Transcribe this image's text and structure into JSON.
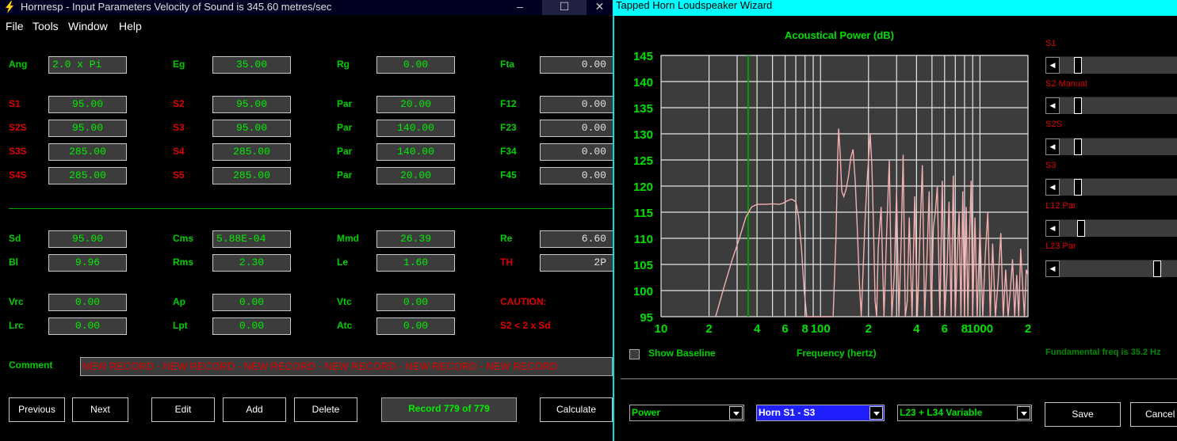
{
  "left_window": {
    "title": "Hornresp - Input Parameters   Velocity of Sound is 345.60 metres/sec",
    "controls": {
      "minimize": "–",
      "maximize": "☐",
      "close": "✕"
    },
    "menu": [
      "File",
      "Tools",
      "Window",
      "Help"
    ],
    "params": {
      "ang": {
        "label": "Ang",
        "value": "2.0 x Pi"
      },
      "eg": {
        "label": "Eg",
        "value": "35.00"
      },
      "rg": {
        "label": "Rg",
        "value": "0.00"
      },
      "fta": {
        "label": "Fta",
        "value": "0.00"
      },
      "s1": {
        "label": "S1",
        "value": "95.00"
      },
      "s2": {
        "label": "S2",
        "value": "95.00"
      },
      "par1": {
        "label": "Par",
        "value": "20.00"
      },
      "f12": {
        "label": "F12",
        "value": "0.00"
      },
      "s2s": {
        "label": "S2S",
        "value": "95.00"
      },
      "s3": {
        "label": "S3",
        "value": "95.00"
      },
      "par2": {
        "label": "Par",
        "value": "140.00"
      },
      "f23": {
        "label": "F23",
        "value": "0.00"
      },
      "s3s": {
        "label": "S3S",
        "value": "285.00"
      },
      "s4": {
        "label": "S4",
        "value": "285.00"
      },
      "par3": {
        "label": "Par",
        "value": "140.00"
      },
      "f34": {
        "label": "F34",
        "value": "0.00"
      },
      "s4s": {
        "label": "S4S",
        "value": "285.00"
      },
      "s5": {
        "label": "S5",
        "value": "285.00"
      },
      "par4": {
        "label": "Par",
        "value": "20.00"
      },
      "f45": {
        "label": "F45",
        "value": "0.00"
      },
      "sd": {
        "label": "Sd",
        "value": "95.00"
      },
      "cms": {
        "label": "Cms",
        "value": "5.88E-04"
      },
      "mmd": {
        "label": "Mmd",
        "value": "26.39"
      },
      "re": {
        "label": "Re",
        "value": "6.60"
      },
      "bl": {
        "label": "Bl",
        "value": "9.96"
      },
      "rms": {
        "label": "Rms",
        "value": "2.30"
      },
      "le": {
        "label": "Le",
        "value": "1.60"
      },
      "th": {
        "label": "TH",
        "value": "2P"
      },
      "vrc": {
        "label": "Vrc",
        "value": "0.00"
      },
      "ap": {
        "label": "Ap",
        "value": "0.00"
      },
      "vtc": {
        "label": "Vtc",
        "value": "0.00"
      },
      "lrc": {
        "label": "Lrc",
        "value": "0.00"
      },
      "lpt": {
        "label": "Lpt",
        "value": "0.00"
      },
      "atc": {
        "label": "Atc",
        "value": "0.00"
      }
    },
    "caution": {
      "title": "CAUTION:",
      "text": "S2 < 2 x Sd"
    },
    "comment": {
      "label": "Comment",
      "value": "NEW RECORD - NEW RECORD - NEW RECORD - NEW RECORD - NEW RECORD - NEW RECORD"
    },
    "buttons": {
      "previous": "Previous",
      "next": "Next",
      "edit": "Edit",
      "add": "Add",
      "delete": "Delete",
      "calculate": "Calculate"
    },
    "record": "Record 779 of 779"
  },
  "right_window": {
    "title": "Tapped Horn Loudspeaker Wizard",
    "sliders": [
      {
        "label": "S1",
        "value": 0.12
      },
      {
        "label": "S2  Manual",
        "value": 0.12
      },
      {
        "label": "S2S",
        "value": 0.12
      },
      {
        "label": "S3",
        "value": 0.12
      },
      {
        "label": "L12  Par",
        "value": 0.15
      },
      {
        "label": "L23  Par",
        "value": 0.8
      }
    ],
    "show_baseline": "Show Baseline",
    "fundamental": "Fundamental freq is 35.2 Hz",
    "dropdowns": {
      "power": "Power",
      "horn": "Horn S1 - S3",
      "variable": "L23 + L34 Variable"
    },
    "buttons": {
      "save": "Save",
      "cancel": "Cancel"
    }
  },
  "chart_data": {
    "type": "line",
    "title": "Acoustical Power (dB)",
    "xlabel": "Frequency (hertz)",
    "ylabel": "",
    "x_scale": "log",
    "xlim": [
      10,
      2000
    ],
    "ylim": [
      95,
      145
    ],
    "y_ticks": [
      "145",
      "140",
      "135",
      "130",
      "125",
      "120",
      "115",
      "110",
      "105",
      "100",
      "95"
    ],
    "x_ticks": [
      "10",
      "2",
      "4",
      "6",
      "8",
      "100",
      "2",
      "4",
      "6",
      "8",
      "1000",
      "2"
    ],
    "marker_freq": 35.2,
    "grid": true,
    "series": [
      {
        "color": "#f4b0b0",
        "x": [
          22,
          25,
          28,
          31,
          34,
          37,
          40,
          45,
          50,
          55,
          58,
          62,
          66,
          70,
          73,
          76,
          79,
          82,
          86,
          90,
          95,
          100,
          105,
          110,
          115,
          120,
          125,
          128,
          130,
          133,
          136,
          140,
          145,
          150,
          155,
          160,
          165,
          170,
          175,
          180,
          185,
          190,
          195,
          200,
          205,
          210,
          215,
          220,
          225,
          230,
          240,
          250,
          260,
          270,
          280,
          290,
          300,
          310,
          320,
          330,
          340,
          350,
          360,
          375,
          390,
          405,
          420,
          435,
          450,
          465,
          480,
          495,
          510,
          525,
          540,
          560,
          580,
          600,
          620,
          640,
          660,
          680,
          700,
          720,
          740,
          760,
          780,
          800,
          820,
          840,
          860,
          880,
          900,
          930,
          960,
          1000,
          1040,
          1080,
          1120,
          1160,
          1200,
          1250,
          1300,
          1350,
          1400,
          1450,
          1500,
          1550,
          1600,
          1650,
          1700,
          1750,
          1800,
          1850,
          1900,
          1950,
          2000
        ],
        "y": [
          95,
          101,
          106,
          110,
          114,
          116,
          116.5,
          116.5,
          116.6,
          116.5,
          116.7,
          117.2,
          117.5,
          117,
          114,
          108,
          100,
          95,
          95,
          95,
          95,
          95,
          95,
          95,
          95,
          95,
          110,
          125,
          131,
          126,
          119,
          118,
          119.5,
          122,
          125.5,
          127,
          121,
          112,
          102,
          95,
          104,
          113,
          120,
          125,
          130,
          124,
          112,
          98,
          95,
          108,
          116,
          95,
          111,
          125,
          95,
          103,
          119,
          95,
          109,
          126,
          95,
          98,
          114,
          95,
          118,
          95,
          110,
          124,
          95,
          106,
          119,
          95,
          112,
          115,
          120,
          95,
          121,
          95,
          103,
          117,
          95,
          122,
          95,
          106,
          115,
          95,
          119,
          95,
          116,
          95,
          110,
          121,
          95,
          114,
          95,
          112,
          95,
          107,
          115,
          95,
          109,
          95,
          102,
          111,
          95,
          104,
          95,
          100,
          106,
          95,
          103,
          95,
          108,
          101,
          95,
          104,
          103
        ]
      }
    ]
  }
}
